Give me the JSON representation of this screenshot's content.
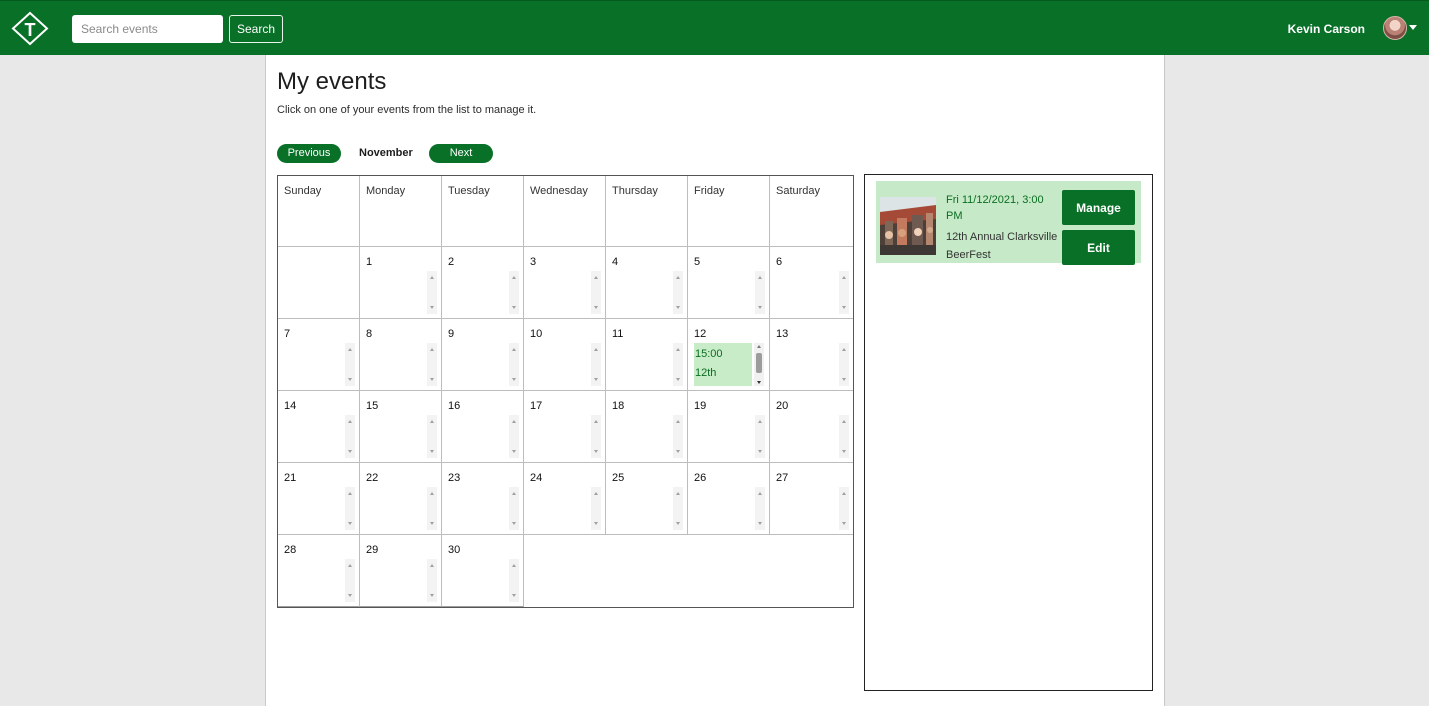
{
  "header": {
    "logo_letter": "T",
    "search": {
      "placeholder": "Search events",
      "button": "Search"
    },
    "user": {
      "name": "Kevin Carson"
    }
  },
  "page": {
    "title": "My events",
    "subtitle": "Click on one of your events from the list to manage it."
  },
  "calendar": {
    "month": "November",
    "previous": "Previous",
    "next": "Next",
    "weekdays": [
      "Sunday",
      "Monday",
      "Tuesday",
      "Wednesday",
      "Thursday",
      "Friday",
      "Saturday"
    ],
    "dates": [
      "1",
      "2",
      "3",
      "4",
      "5",
      "6",
      "7",
      "8",
      "9",
      "10",
      "11",
      "12",
      "13",
      "14",
      "15",
      "16",
      "17",
      "18",
      "19",
      "20",
      "21",
      "22",
      "23",
      "24",
      "25",
      "26",
      "27",
      "28",
      "29",
      "30"
    ],
    "event_in_cell": {
      "date": "12",
      "time": "15:00",
      "text": "12th"
    }
  },
  "event_list": [
    {
      "datetime": "Fri 11/12/2021, 3:00 PM",
      "name": "12th Annual Clarksville BeerFest",
      "manage": "Manage",
      "edit": "Edit"
    }
  ],
  "colors": {
    "brand": "#087027",
    "event_bg": "#c8ebc8",
    "page_bg": "#e8e8e8"
  }
}
